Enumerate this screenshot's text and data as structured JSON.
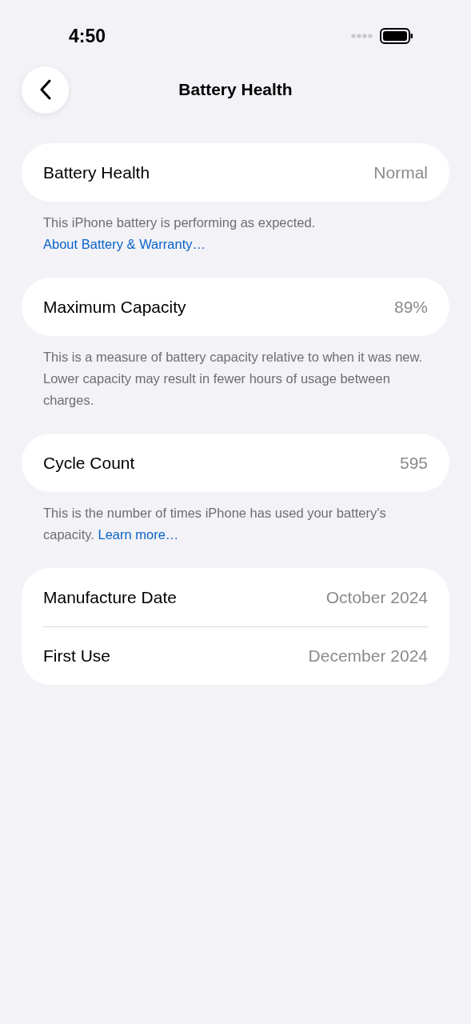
{
  "status_bar": {
    "time": "4:50"
  },
  "nav": {
    "title": "Battery Health"
  },
  "sections": [
    {
      "rows": [
        {
          "label": "Battery Health",
          "value": "Normal"
        }
      ],
      "footer": {
        "text": "This iPhone battery is performing as expected.",
        "link": "About Battery & Warranty…"
      }
    },
    {
      "rows": [
        {
          "label": "Maximum Capacity",
          "value": "89%"
        }
      ],
      "footer": {
        "text": "This is a measure of battery capacity relative to when it was new. Lower capacity may result in fewer hours of usage between charges."
      }
    },
    {
      "rows": [
        {
          "label": "Cycle Count",
          "value": "595"
        }
      ],
      "footer": {
        "text": "This is the number of times iPhone has used your battery's capacity.",
        "link": "Learn more…"
      }
    },
    {
      "rows": [
        {
          "label": "Manufacture Date",
          "value": "October 2024"
        },
        {
          "label": "First Use",
          "value": "December 2024"
        }
      ]
    }
  ]
}
